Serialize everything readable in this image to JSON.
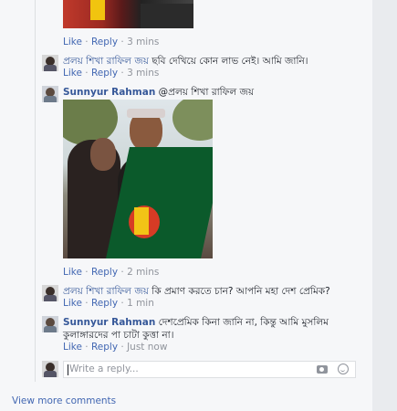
{
  "thread": {
    "top_actions": {
      "like": "Like",
      "reply": "Reply",
      "time": "3 mins"
    },
    "comments": [
      {
        "author": "প্রলয় শিখা রাফিল জয়",
        "text": "ছবি দেখিয়ে কোন লাভ নেই। আমি জানি।",
        "actions": {
          "like": "Like",
          "reply": "Reply",
          "time": "3 mins"
        }
      },
      {
        "author": "Sunnyur Rahman",
        "mention": "@প্রলয় শিখা রাফিল জয়",
        "actions": {
          "like": "Like",
          "reply": "Reply",
          "time": "2 mins"
        }
      },
      {
        "author": "প্রলয় শিখা রাফিল জয়",
        "text": "কি প্রমাণ করতে চান? আপনি মহা দেশ প্রেমিক?",
        "actions": {
          "like": "Like",
          "reply": "Reply",
          "time": "1 min"
        }
      },
      {
        "author": "Sunnyur Rahman",
        "text": "দেশপ্রেমিক কিনা জানি না, কিন্তু আমি মুসলিম কুলাঙ্গারদের পা চাটা কুত্তা না।",
        "actions": {
          "like": "Like",
          "reply": "Reply",
          "time": "Just now"
        }
      }
    ],
    "separator": " · "
  },
  "reply_box": {
    "placeholder": "Write a reply..."
  },
  "view_more": "View more comments",
  "icons": [
    "camera-icon",
    "smiley-icon"
  ],
  "colors": {
    "link": "#4267b2",
    "author": "#365899",
    "meta": "#90949c",
    "background": "#f6f7f9"
  }
}
